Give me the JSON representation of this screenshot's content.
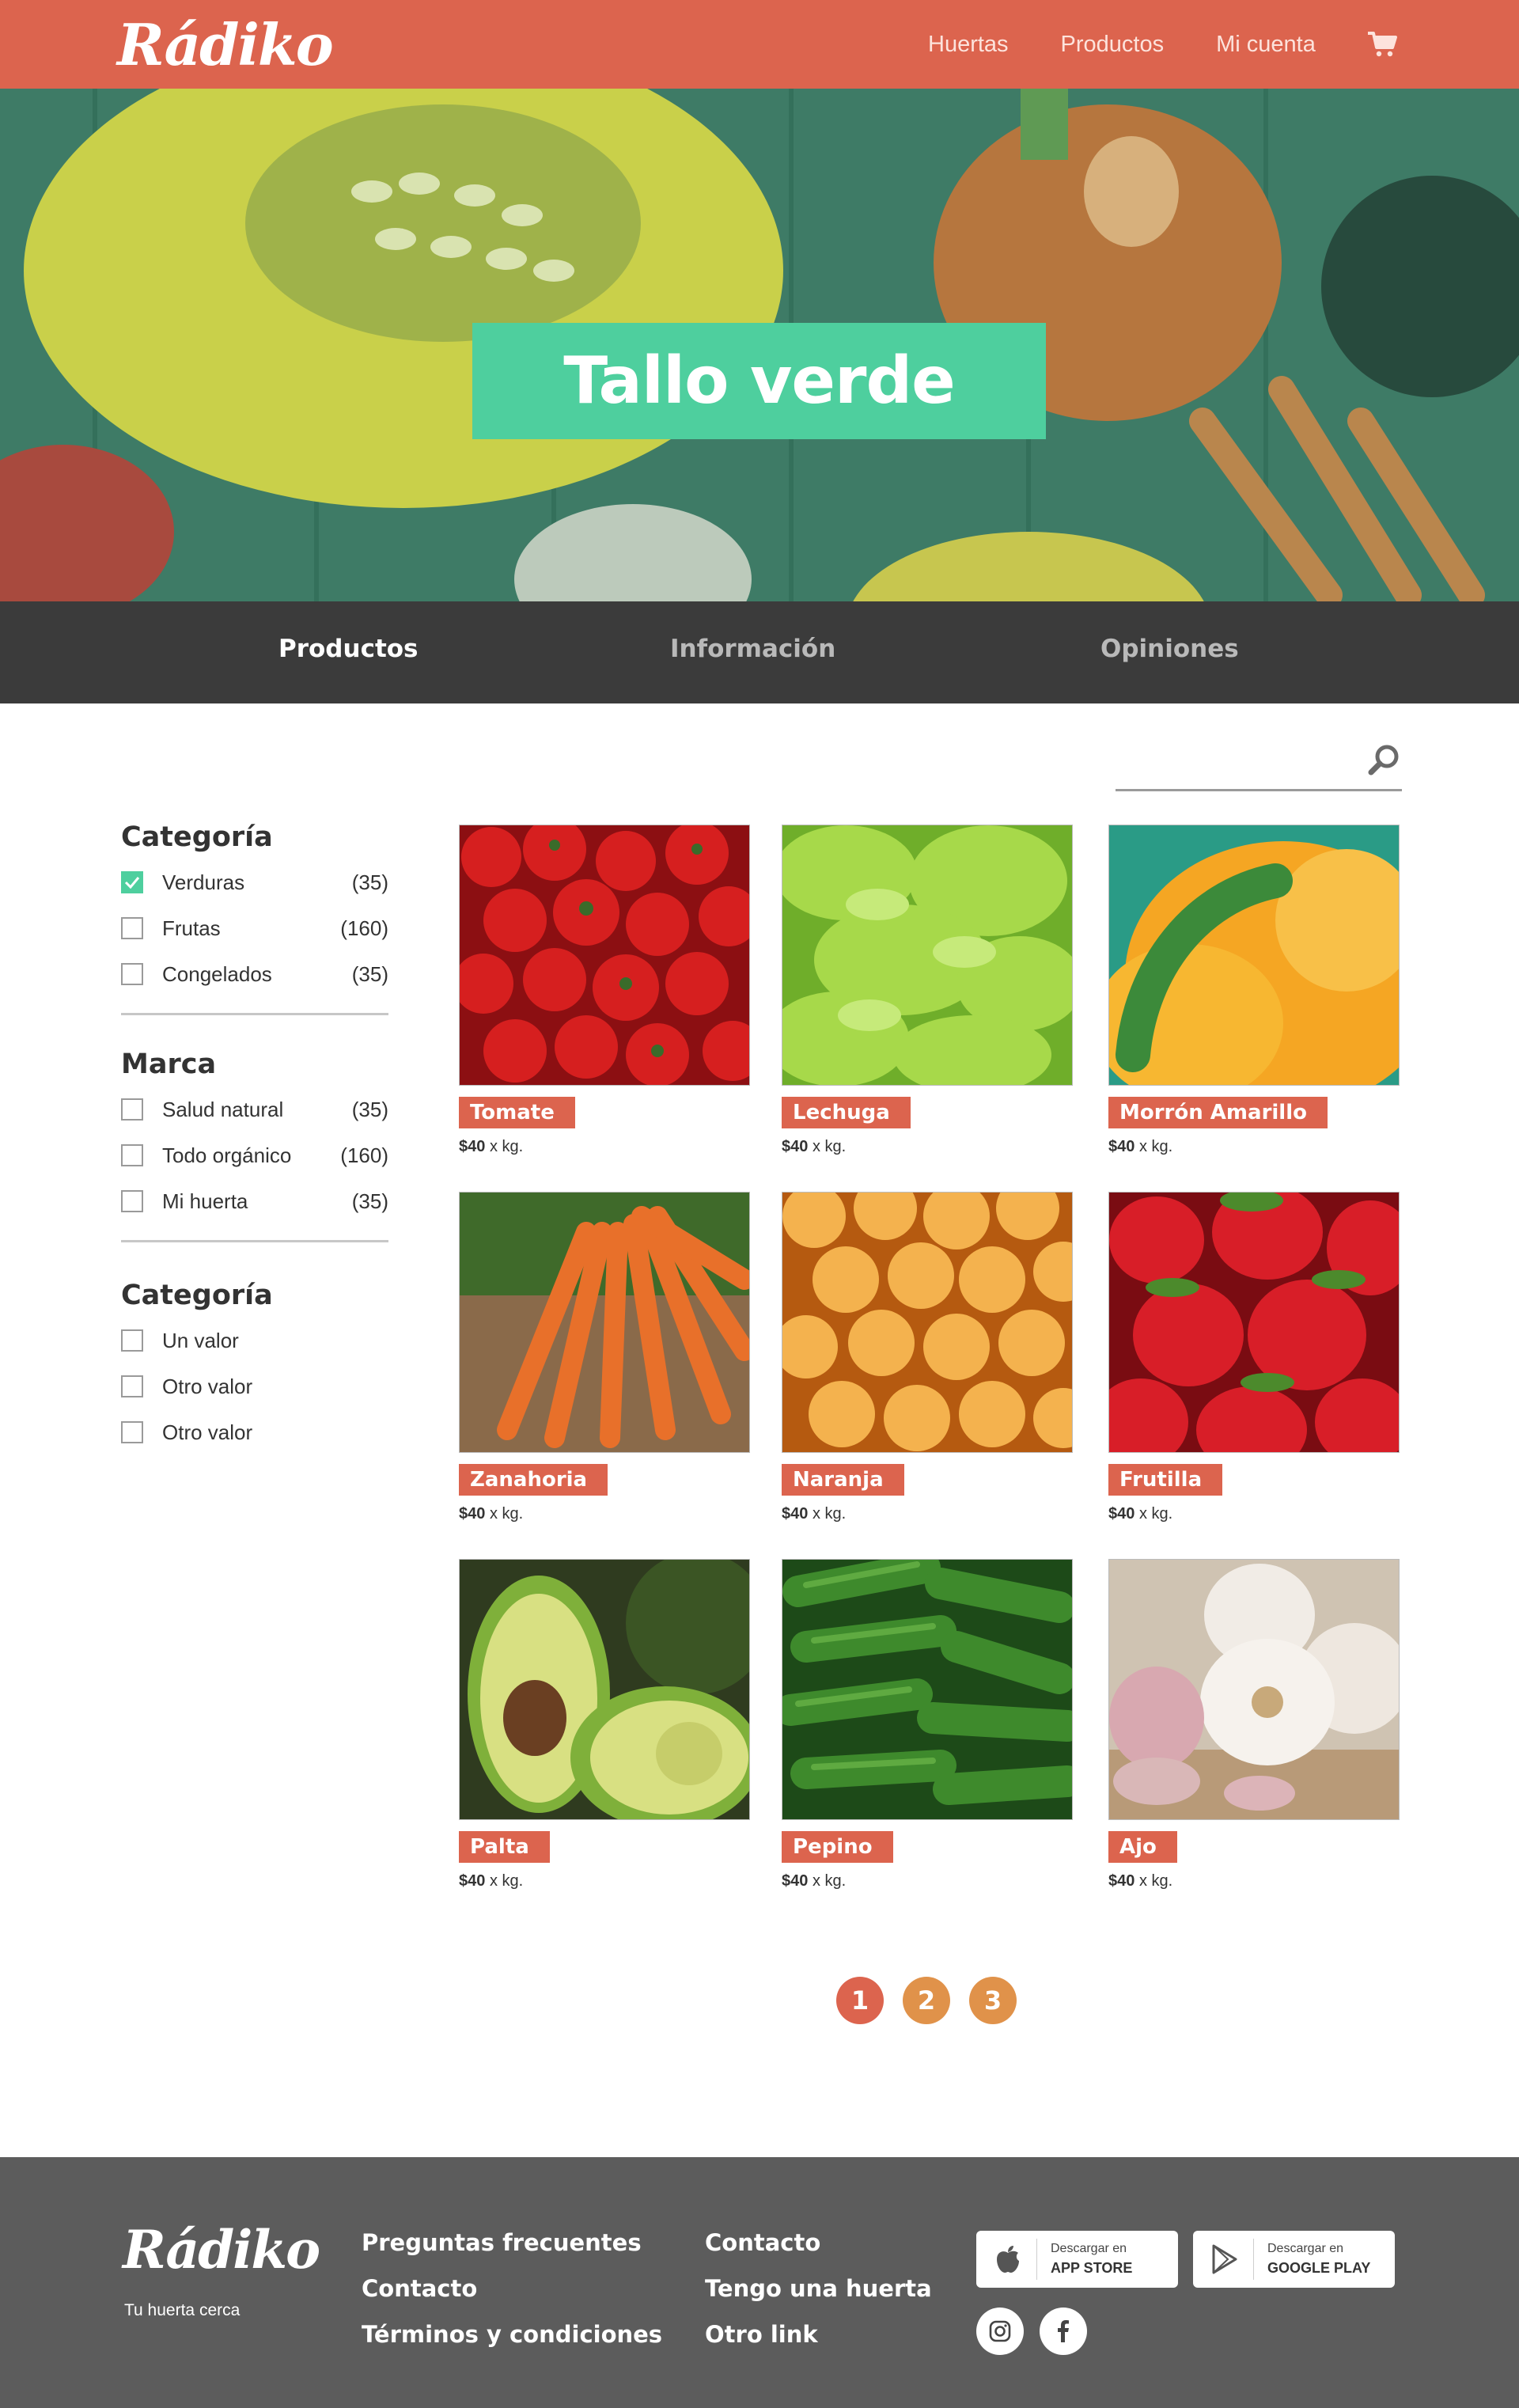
{
  "header": {
    "logo": "Rádiko",
    "nav": [
      "Huertas",
      "Productos",
      "Mi cuenta"
    ]
  },
  "hero": {
    "title": "Tallo verde"
  },
  "tabs": [
    {
      "label": "Productos",
      "active": true
    },
    {
      "label": "Información",
      "active": false
    },
    {
      "label": "Opiniones",
      "active": false
    }
  ],
  "search": {
    "placeholder": ""
  },
  "filters": [
    {
      "title": "Categoría",
      "items": [
        {
          "label": "Verduras",
          "count": "(35)",
          "checked": true
        },
        {
          "label": "Frutas",
          "count": "(160)",
          "checked": false
        },
        {
          "label": "Congelados",
          "count": "(35)",
          "checked": false
        }
      ]
    },
    {
      "title": "Marca",
      "items": [
        {
          "label": "Salud natural",
          "count": "(35)",
          "checked": false
        },
        {
          "label": "Todo orgánico",
          "count": "(160)",
          "checked": false
        },
        {
          "label": "Mi huerta",
          "count": "(35)",
          "checked": false
        }
      ]
    },
    {
      "title": "Categoría",
      "items": [
        {
          "label": "Un valor",
          "count": "",
          "checked": false
        },
        {
          "label": "Otro valor",
          "count": "",
          "checked": false
        },
        {
          "label": "Otro valor",
          "count": "",
          "checked": false
        }
      ]
    }
  ],
  "products": [
    {
      "name": "Tomate",
      "price": "$40",
      "unit": "x kg.",
      "image": "tomato"
    },
    {
      "name": "Lechuga",
      "price": "$40",
      "unit": "x kg.",
      "image": "lettuce"
    },
    {
      "name": "Morrón Amarillo",
      "price": "$40",
      "unit": "x kg.",
      "image": "yellow-pepper"
    },
    {
      "name": "Zanahoria",
      "price": "$40",
      "unit": "x kg.",
      "image": "carrot"
    },
    {
      "name": "Naranja",
      "price": "$40",
      "unit": "x kg.",
      "image": "orange"
    },
    {
      "name": "Frutilla",
      "price": "$40",
      "unit": "x kg.",
      "image": "strawberry"
    },
    {
      "name": "Palta",
      "price": "$40",
      "unit": "x kg.",
      "image": "avocado"
    },
    {
      "name": "Pepino",
      "price": "$40",
      "unit": "x kg.",
      "image": "cucumber"
    },
    {
      "name": "Ajo",
      "price": "$40",
      "unit": "x kg.",
      "image": "garlic"
    }
  ],
  "pagination": {
    "pages": [
      "1",
      "2",
      "3"
    ],
    "current": "1"
  },
  "footer": {
    "logo": "Rádiko",
    "tagline": "Tu huerta cerca",
    "col1": [
      "Preguntas frecuentes",
      "Contacto",
      "Términos y condiciones"
    ],
    "col2": [
      "Contacto",
      "Tengo una huerta",
      "Otro link"
    ],
    "app_store": {
      "small": "Descargar en",
      "big": "APP STORE"
    },
    "google_play": {
      "small": "Descargar en",
      "big": "GOOGLE PLAY"
    },
    "social": [
      "instagram-icon",
      "facebook-icon"
    ]
  },
  "colors": {
    "brand": "#dc644e",
    "accent_green": "#4ecf9e",
    "tab_bar": "#3b3b3b",
    "footer": "#5c5c5c",
    "page_active": "#dc644e",
    "page_inactive": "#e0924a"
  }
}
